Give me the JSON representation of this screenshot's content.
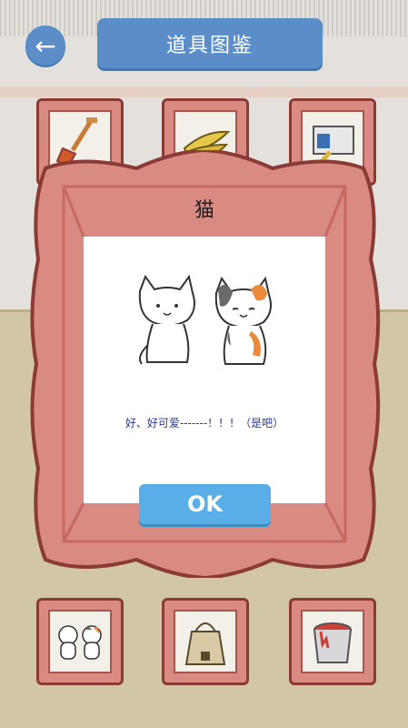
{
  "header": {
    "title": "道具图鉴"
  },
  "back": {
    "icon": "arrow-left-icon"
  },
  "modal": {
    "title": "猫",
    "description": "好、好可爱-------！！！（是吧）",
    "ok_label": "OK",
    "illustration": "two-cats-icon"
  },
  "collection_items": [
    {
      "icon": "shovel-icon"
    },
    {
      "icon": "bananas-icon"
    },
    {
      "icon": "box-pack-icon"
    },
    {
      "icon": "two-cats-icon"
    },
    {
      "icon": "bag-icon"
    },
    {
      "icon": "paint-bucket-icon"
    }
  ],
  "colors": {
    "accent_blue": "#5b8ec9",
    "ok_blue": "#5aaee8",
    "frame_pink": "#d98a82",
    "frame_border": "#8b3b36"
  }
}
